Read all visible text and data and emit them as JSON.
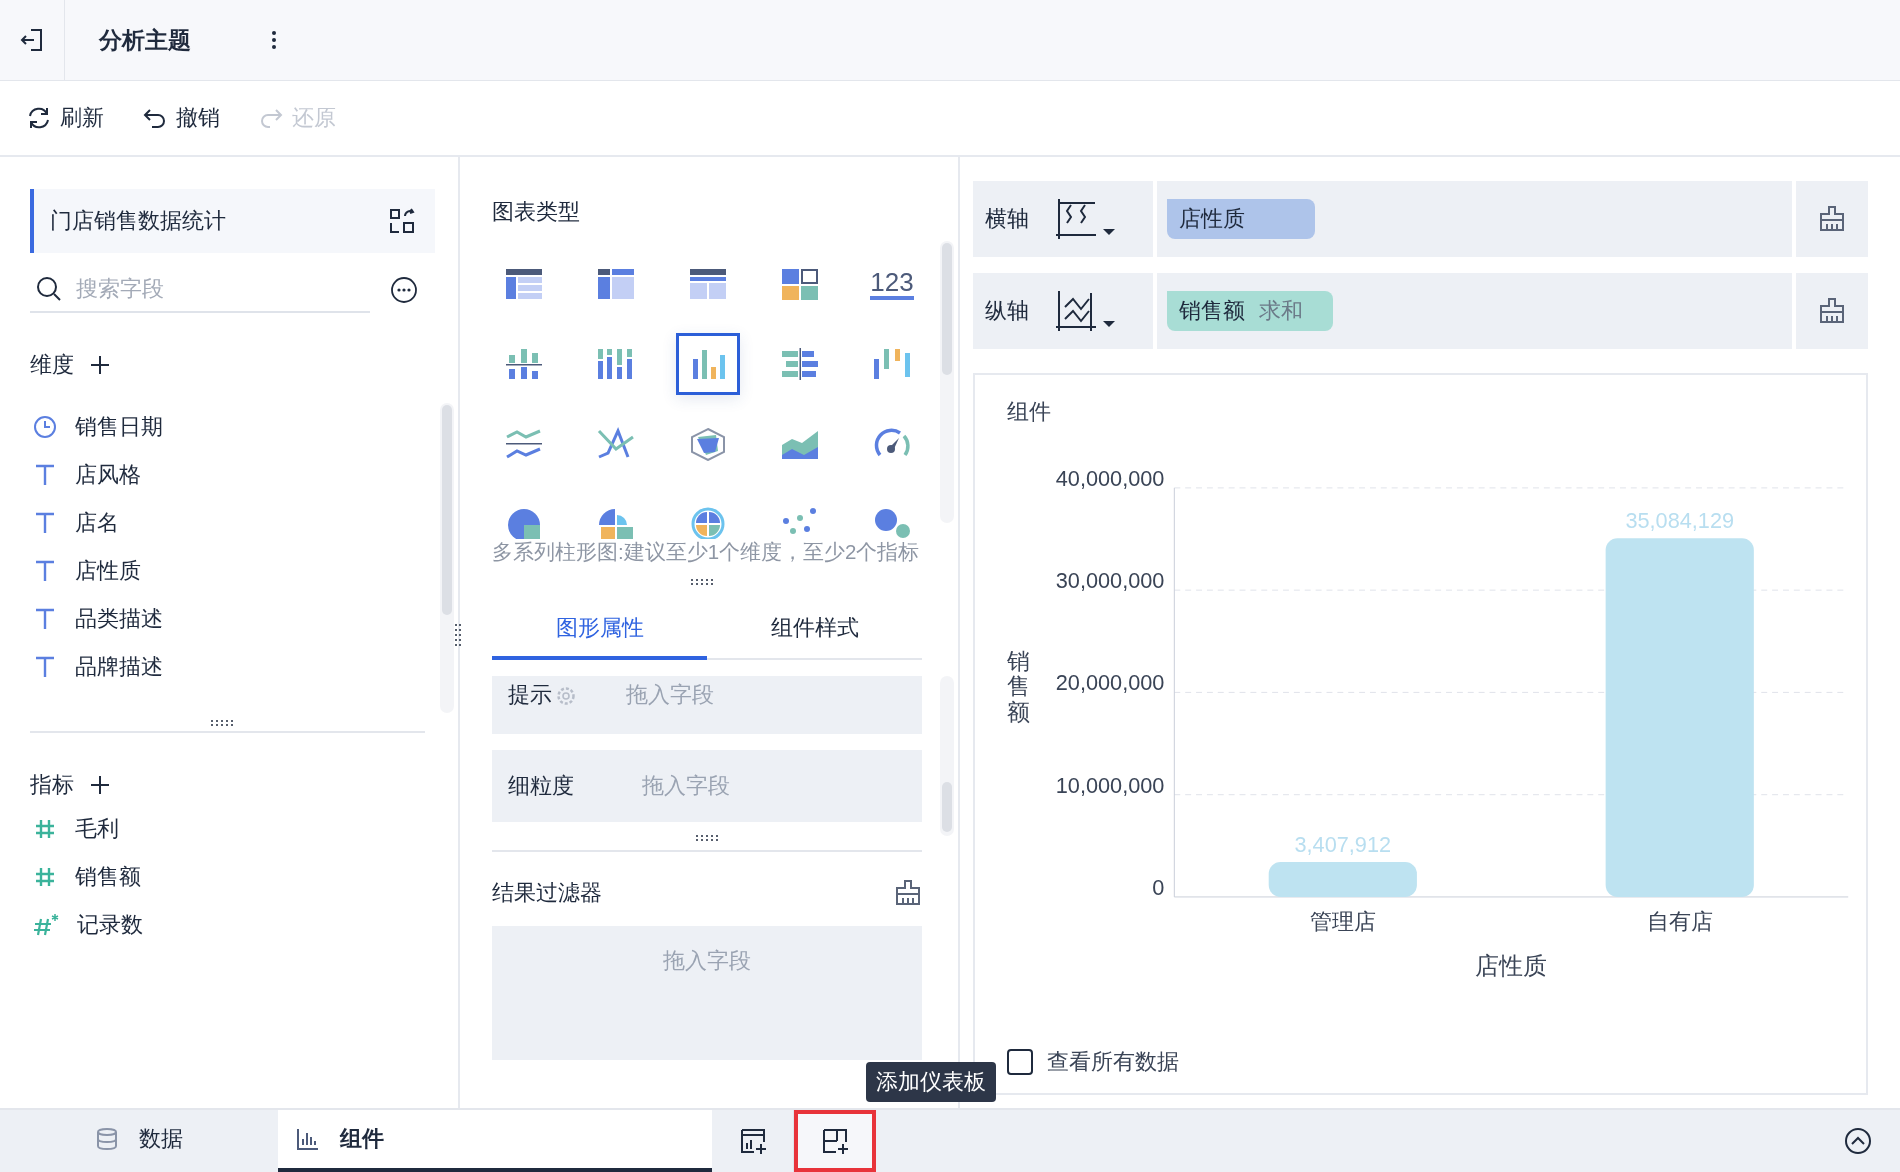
{
  "header": {
    "title": "分析主题"
  },
  "toolbar": [
    {
      "label": "刷新",
      "kind": "refresh",
      "disabled": false
    },
    {
      "label": "撤销",
      "kind": "undo",
      "disabled": false
    },
    {
      "label": "还原",
      "kind": "redo",
      "disabled": true
    }
  ],
  "dataset": {
    "name": "门店销售数据统计"
  },
  "search": {
    "placeholder": "搜索字段"
  },
  "dimensions": {
    "title": "维度",
    "items": [
      {
        "name": "销售日期",
        "kind": "date"
      },
      {
        "name": "店风格",
        "kind": "text"
      },
      {
        "name": "店名",
        "kind": "text"
      },
      {
        "name": "店性质",
        "kind": "text"
      },
      {
        "name": "品类描述",
        "kind": "text"
      },
      {
        "name": "品牌描述",
        "kind": "text"
      }
    ]
  },
  "measures": {
    "title": "指标",
    "items": [
      {
        "name": "毛利",
        "kind": "number"
      },
      {
        "name": "销售额",
        "kind": "number"
      },
      {
        "name": "记录数",
        "kind": "count"
      }
    ]
  },
  "chart_types": {
    "title": "图表类型",
    "hint": "多系列柱形图:建议至少1个维度，至少2个指标",
    "items": [
      {
        "kind": "detail-table",
        "selected": false
      },
      {
        "kind": "crosstable",
        "selected": false
      },
      {
        "kind": "grouped-table",
        "selected": false
      },
      {
        "kind": "card-grid",
        "selected": false
      },
      {
        "kind": "kpi",
        "label": "123",
        "selected": false
      },
      {
        "kind": "diverging-bar",
        "selected": false
      },
      {
        "kind": "stacked-bar",
        "selected": false
      },
      {
        "kind": "multi-bar",
        "selected": true
      },
      {
        "kind": "compare-bar",
        "selected": false
      },
      {
        "kind": "range-bar",
        "selected": false
      },
      {
        "kind": "multi-line",
        "selected": false
      },
      {
        "kind": "cross-line",
        "selected": false
      },
      {
        "kind": "radar",
        "selected": false
      },
      {
        "kind": "area",
        "selected": false
      },
      {
        "kind": "gauge",
        "selected": false
      },
      {
        "kind": "pie",
        "selected": false
      },
      {
        "kind": "rose",
        "selected": false
      },
      {
        "kind": "sunburst",
        "selected": false
      },
      {
        "kind": "scatter",
        "selected": false
      },
      {
        "kind": "bubble",
        "selected": false
      }
    ]
  },
  "property_tabs": [
    {
      "label": "图形属性",
      "selected": true
    },
    {
      "label": "组件样式",
      "selected": false
    }
  ],
  "property_fields": [
    {
      "label": "提示",
      "placeholder": "拖入字段",
      "kind": "tooltip"
    },
    {
      "label": "细粒度",
      "placeholder": "拖入字段",
      "kind": "plain"
    }
  ],
  "result_filter": {
    "title": "结果过滤器",
    "placeholder": "拖入字段"
  },
  "axes": [
    {
      "label": "横轴",
      "kind": "x",
      "fields": [
        {
          "name": "店性质",
          "kind": "dimension"
        }
      ]
    },
    {
      "label": "纵轴",
      "kind": "y",
      "fields": [
        {
          "name": "销售额",
          "aggregation": "求和",
          "kind": "measure"
        }
      ]
    }
  ],
  "chart_card": {
    "title": "组件",
    "view_all": {
      "label": "查看所有数据",
      "checked": false
    },
    "chart_data": {
      "type": "bar",
      "xlabel": "店性质",
      "ylabel": "销售额",
      "categories": [
        "管理店",
        "自有店"
      ],
      "values": [
        3407912,
        35084129
      ],
      "grid": true,
      "ylim": [
        0,
        40000000
      ],
      "yticks": [
        {
          "value": 0,
          "label": "0"
        },
        {
          "value": 10000000,
          "label": "10,000,000"
        },
        {
          "value": 20000000,
          "label": "20,000,000"
        },
        {
          "value": 30000000,
          "label": "30,000,000"
        },
        {
          "value": 40000000,
          "label": "40,000,000"
        }
      ],
      "value_labels": [
        "3,407,912",
        "35,084,129"
      ]
    }
  },
  "bottom_tabs": [
    {
      "label": "数据",
      "kind": "data",
      "selected": false
    },
    {
      "label": "组件",
      "kind": "widget",
      "selected": true
    }
  ],
  "bottom_actions": [
    {
      "kind": "add-widget",
      "highlighted": false
    },
    {
      "kind": "add-dashboard",
      "highlighted": true
    }
  ],
  "tooltip": {
    "text": "添加仪表板"
  }
}
